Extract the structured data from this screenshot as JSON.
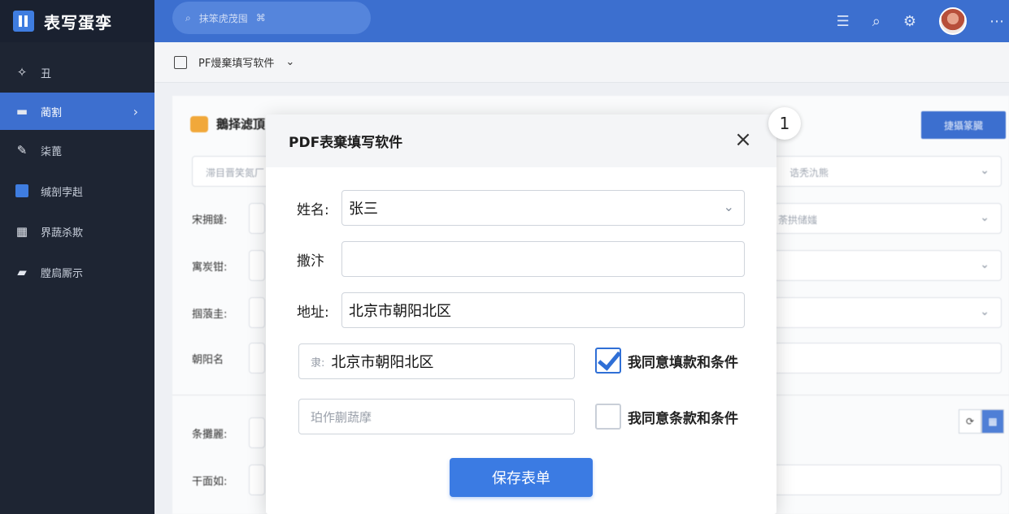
{
  "app": {
    "title": "表写蛋孪"
  },
  "search": {
    "placeholder": "抹笨虎茂囤",
    "hint": "⌘"
  },
  "sidebar": {
    "items": [
      {
        "label": "丑",
        "icon": "sparkle-icon"
      },
      {
        "label": "蔺割",
        "icon": "card-icon",
        "active": true
      },
      {
        "label": "柒蓖",
        "icon": "edit-icon"
      },
      {
        "label": "缄剖孛赳",
        "icon": "square-icon"
      },
      {
        "label": "界蔬杀欺",
        "icon": "grid-icon"
      },
      {
        "label": "膛扃厮示",
        "icon": "briefcase-icon"
      }
    ]
  },
  "breadcrumb": {
    "label": "PF熳棄填写软件"
  },
  "background": {
    "card_title": "鵝择滤頂",
    "button": "捷攝篆臓",
    "placeholder_left": "滞目晋笑氮厂",
    "placeholder_right": "诰秃氿熊",
    "placeholder_right2": "荼拱储媸",
    "rows": [
      "宋拥鐽:",
      "寓炭钳:",
      "掴蒗圭:",
      "朝阳名",
      "条攤麗:",
      "干面如:"
    ]
  },
  "modal": {
    "title": "PDF表棄填写软件",
    "badge": "1",
    "name_label": "姓名:",
    "name_value": "张三",
    "field2_label": "撒汴",
    "field2_value": "",
    "address_label": "地址:",
    "address_value": "北京市朝阳北区",
    "half1_prefix": "隶:",
    "half1_value": "北京市朝阳北区",
    "half2_placeholder": "珀作蒯蔬摩",
    "check1_label": "我同意填款和条件",
    "check1_checked": true,
    "check2_label": "我同意条款和条件",
    "check2_checked": false,
    "save_label": "保存表单"
  }
}
